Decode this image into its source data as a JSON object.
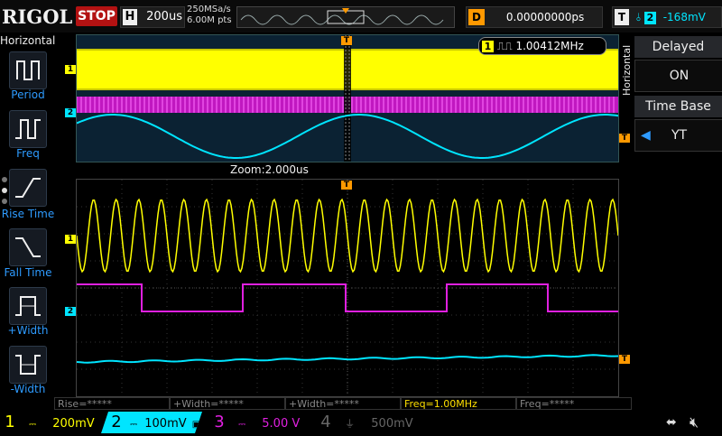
{
  "topbar": {
    "logo": "RIGOL",
    "run_state": "STOP",
    "h_key": "H",
    "timebase": "200us",
    "sample_rate": "250MSa/s",
    "memory_depth": "6.00M pts",
    "d_key": "D",
    "delay": "0.00000000ps",
    "t_key": "T",
    "trigger_channel": "2",
    "trigger_level": "-168mV"
  },
  "left_menu": {
    "title": "Horizontal",
    "items": [
      {
        "label": "Period",
        "icon": "period-icon"
      },
      {
        "label": "Freq",
        "icon": "freq-icon"
      },
      {
        "label": "Rise Time",
        "icon": "rise-time-icon"
      },
      {
        "label": "Fall Time",
        "icon": "fall-time-icon"
      },
      {
        "label": "+Width",
        "icon": "plus-width-icon"
      },
      {
        "label": "-Width",
        "icon": "minus-width-icon"
      }
    ]
  },
  "right_panel": {
    "vertical_title": "Horizontal",
    "delayed_label": "Delayed",
    "delayed_value": "ON",
    "timebase_label": "Time Base",
    "timebase_value": "YT"
  },
  "main_view": {
    "freq_badge_channel": "1",
    "freq_badge_value": "1.00412MHz",
    "zoom_label": "Zoom:2.000us"
  },
  "measurements": [
    {
      "text": "Rise=*****",
      "active": false
    },
    {
      "text": "+Width=*****",
      "active": false
    },
    {
      "text": "+Width=*****",
      "active": false
    },
    {
      "text": "Freq=1.00MHz",
      "active": true
    },
    {
      "text": "Freq=*****",
      "active": false
    }
  ],
  "channels": [
    {
      "num": "1",
      "scale": "200mV",
      "color": "#ffff00"
    },
    {
      "num": "2",
      "scale": "100mV",
      "color": "#00e5ff"
    },
    {
      "num": "3",
      "scale": "5.00 V",
      "color": "#e020e0"
    },
    {
      "num": "4",
      "scale": "500mV",
      "color": "#666666"
    }
  ],
  "markers": {
    "ch1": "1",
    "ch2": "2",
    "trigger": "T"
  },
  "colors": {
    "ch1": "#ffff00",
    "ch2": "#00e5ff",
    "ch3": "#e020e0",
    "trigger": "#ff9900",
    "stop": "#b31212",
    "accent_blue": "#2e9bff"
  }
}
